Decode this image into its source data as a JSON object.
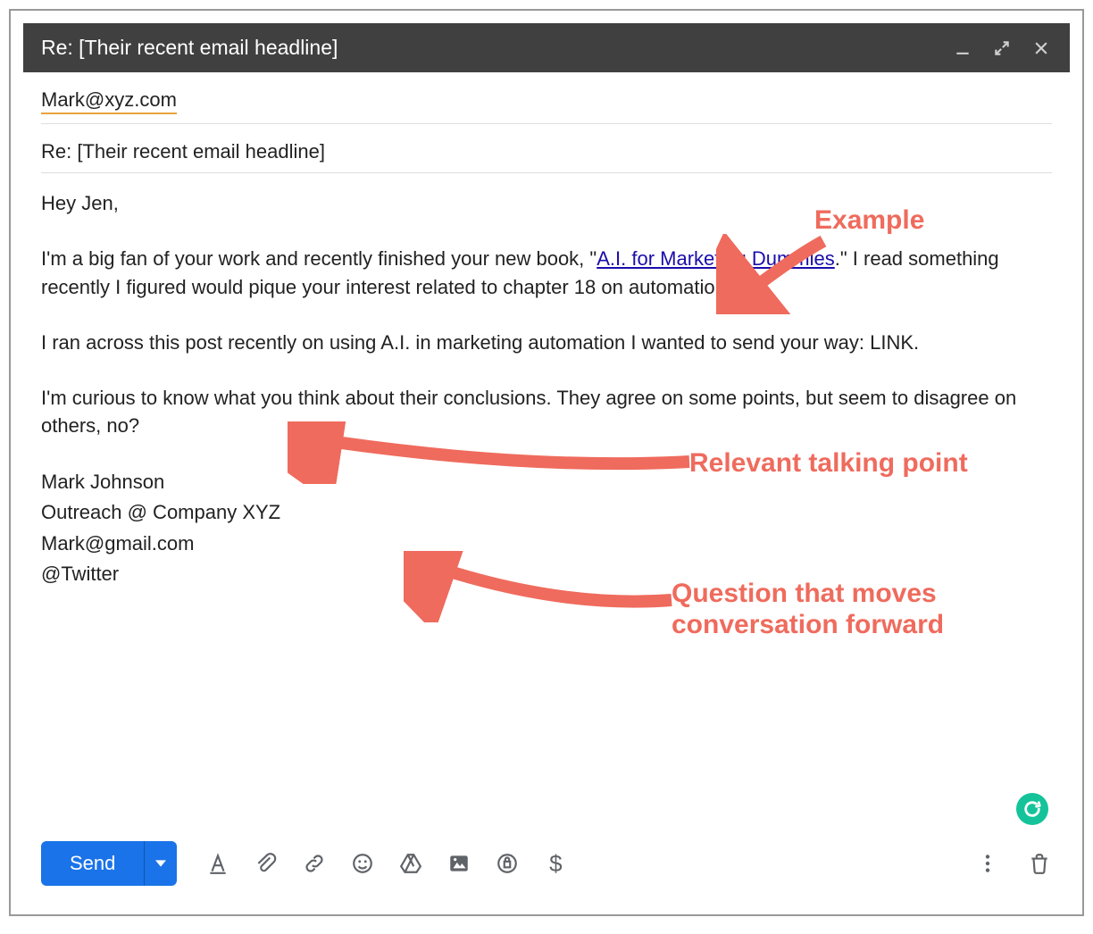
{
  "titlebar": {
    "title": "Re: [Their recent email headline]"
  },
  "fields": {
    "to": "Mark@xyz.com",
    "subject": "Re: [Their recent email headline]"
  },
  "body": {
    "greeting": "Hey Jen,",
    "p1_pre": "I'm a big fan of your work and recently finished your new book, \"",
    "p1_link": "A.I. for Marketing Dummies",
    "p1_post": ".\" I read something recently I figured would pique your interest related to chapter 18 on automation.",
    "p2": "I ran across this post recently on using A.I. in marketing automation I wanted to send your way: LINK.",
    "p3": "I'm curious to know what you think about their conclusions. They agree on some points, but seem to disagree on others, no?",
    "signature": {
      "name": "Mark Johnson",
      "role": "Outreach @ Company XYZ",
      "email": "Mark@gmail.com",
      "twitter": "@Twitter"
    }
  },
  "toolbar": {
    "send_label": "Send",
    "dollar_label": "$"
  },
  "annotations": {
    "a1": "Example",
    "a2": "Relevant talking point",
    "a3_line1": "Question that moves",
    "a3_line2": "conversation forward"
  }
}
